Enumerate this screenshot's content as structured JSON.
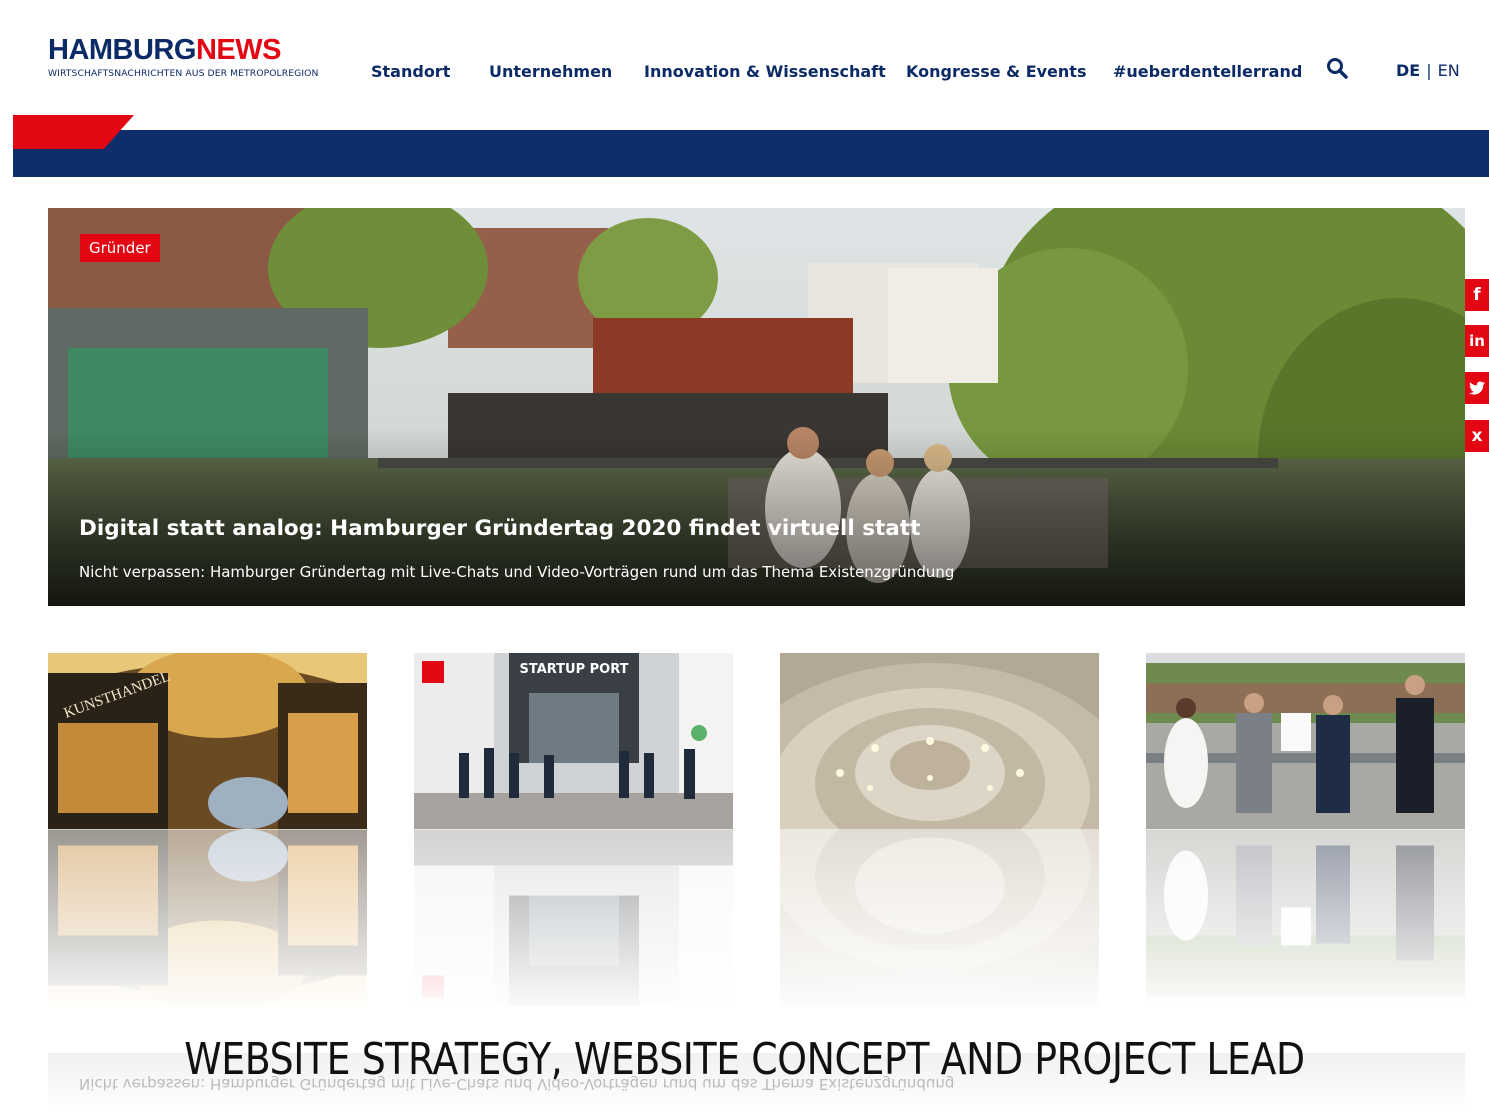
{
  "header": {
    "logo_main_1": "HAMBURG",
    "logo_main_2": "NEWS",
    "logo_sub": "WIRTSCHAFTSNACHRICHTEN AUS DER METROPOLREGION",
    "nav": [
      "Standort",
      "Unternehmen",
      "Innovation & Wissenschaft",
      "Kongresse & Events",
      "#ueberdentellerrand"
    ],
    "search_icon": "search-icon",
    "lang_active": "DE",
    "lang_sep": "|",
    "lang_other": "EN"
  },
  "colors": {
    "navy": "#0e2d6b",
    "red": "#e30613",
    "text_navy": "#0b2a66"
  },
  "hero": {
    "tag": "Gründer",
    "title": "Digital statt analog: Hamburger Gründertag 2020 findet virtuell statt",
    "subtitle": "Nicht verpassen: Hamburger Gründertag mit Live-Chats und Video-Vorträgen rund um das Thema Existenzgründung"
  },
  "social": {
    "facebook": "f",
    "linkedin": "in",
    "twitter": "twitter-icon",
    "xing": "x"
  },
  "thumbnails": [
    {
      "name": "kunsthandel-passage",
      "sign": "KUNSTHANDEL"
    },
    {
      "name": "startup-port",
      "sign": "STARTUP PORT"
    },
    {
      "name": "spiral-ceiling"
    },
    {
      "name": "award-group"
    }
  ],
  "caption": "WEBSITE STRATEGY, WEBSITE CONCEPT AND PROJECT LEAD"
}
